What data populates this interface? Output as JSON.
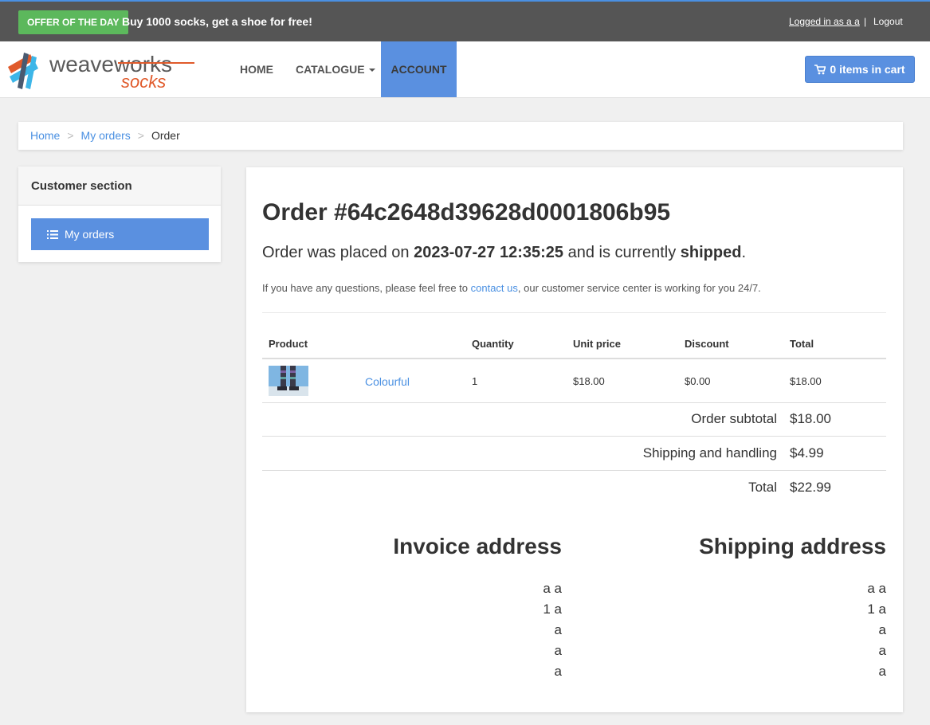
{
  "topbar": {
    "offer_badge": "OFFER OF THE DAY",
    "offer_text": "Buy 1000 socks, get a shoe for free!",
    "login_text": "Logged in as a a",
    "separator": "|",
    "logout": "Logout"
  },
  "navbar": {
    "home": "HOME",
    "catalogue": "CATALOGUE",
    "account": "ACCOUNT",
    "cart": "0 items in cart"
  },
  "breadcrumb": {
    "items": [
      "Home",
      "My orders",
      "Order"
    ],
    "separator": ">"
  },
  "sidebar": {
    "title": "Customer section",
    "my_orders": "My orders"
  },
  "order": {
    "title": "Order #64c2648d39628d0001806b95",
    "status_prefix": "Order was placed on ",
    "date": "2023-07-27 12:35:25",
    "status_mid": " and is currently ",
    "status": "shipped",
    "status_suffix": ".",
    "help_prefix": "If you have any questions, please feel free to ",
    "help_link": "contact us",
    "help_suffix": ", our customer service center is working for you 24/7."
  },
  "table": {
    "headers": [
      "Product",
      "Quantity",
      "Unit price",
      "Discount",
      "Total"
    ],
    "rows": [
      {
        "name": "Colourful",
        "quantity": "1",
        "unit_price": "$18.00",
        "discount": "$0.00",
        "total": "$18.00"
      }
    ]
  },
  "summary": {
    "subtotal_label": "Order subtotal",
    "subtotal_value": "$18.00",
    "shipping_label": "Shipping and handling",
    "shipping_value": "$4.99",
    "total_label": "Total",
    "total_value": "$22.99"
  },
  "invoice_address": {
    "title": "Invoice address",
    "lines": [
      "a a",
      "1 a",
      "a",
      "a",
      "a"
    ]
  },
  "shipping_address": {
    "title": "Shipping address",
    "lines": [
      "a a",
      "1 a",
      "a",
      "a",
      "a"
    ]
  },
  "logo": {
    "text_top": "weaveworks",
    "text_bottom": "socks"
  },
  "colors": {
    "accent": "#5a90e0",
    "offer": "#5cb85c",
    "link": "#4a90e2",
    "logo_orange": "#e05a2b"
  }
}
